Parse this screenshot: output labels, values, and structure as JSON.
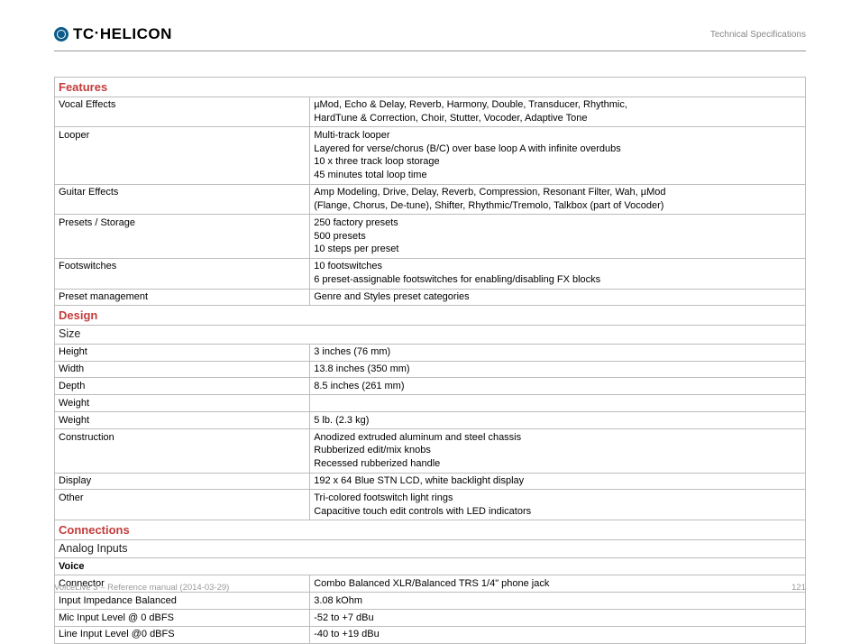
{
  "header": {
    "logo_text_1": "TC",
    "logo_sep": "·",
    "logo_text_2": "HELICON",
    "right_text": "Technical Specifications"
  },
  "sections": {
    "features": {
      "title": "Features",
      "rows": [
        {
          "label": "Vocal Effects",
          "value": "µMod, Echo & Delay, Reverb, Harmony, Double, Transducer, Rhythmic,\nHardTune & Correction, Choir, Stutter, Vocoder, Adaptive Tone"
        },
        {
          "label": "Looper",
          "value": "Multi-track looper\nLayered for verse/chorus (B/C) over base loop A with infinite overdubs\n10 x three track loop storage\n45 minutes total loop time"
        },
        {
          "label": "Guitar Effects",
          "value": "Amp Modeling, Drive, Delay, Reverb, Compression, Resonant Filter, Wah, µMod\n(Flange, Chorus, De-tune), Shifter, Rhythmic/Tremolo, Talkbox (part of Vocoder)"
        },
        {
          "label": "Presets / Storage",
          "value": "250 factory presets\n500 presets\n10 steps per preset"
        },
        {
          "label": "Footswitches",
          "value": "10 footswitches\n6 preset-assignable footswitches for enabling/disabling FX blocks"
        },
        {
          "label": "Preset management",
          "value": "Genre and Styles preset categories"
        }
      ]
    },
    "design": {
      "title": "Design",
      "sub": "Size",
      "rows": [
        {
          "label": "Height",
          "value": "3 inches (76 mm)"
        },
        {
          "label": "Width",
          "value": "13.8 inches (350 mm)"
        },
        {
          "label": "Depth",
          "value": "8.5 inches (261 mm)"
        },
        {
          "label": "Weight",
          "value": ""
        },
        {
          "label": "Weight",
          "value": "5 lb. (2.3 kg)"
        },
        {
          "label": "Construction",
          "value": "Anodized extruded aluminum and steel chassis\nRubberized edit/mix knobs\nRecessed rubberized handle"
        },
        {
          "label": "Display",
          "value": "192 x 64 Blue STN LCD, white backlight display"
        },
        {
          "label": "Other",
          "value": "Tri-colored footswitch light rings\nCapacitive touch edit controls with LED indicators"
        }
      ]
    },
    "connections": {
      "title": "Connections",
      "sub": "Analog Inputs",
      "sub2": "Voice",
      "rows": [
        {
          "label": "Connector",
          "value": "Combo Balanced XLR/Balanced TRS 1/4\" phone jack"
        },
        {
          "label": "Input Impedance Balanced",
          "value": "3.08 kOhm"
        },
        {
          "label": "Mic Input Level @ 0 dBFS",
          "value": "-52 to +7 dBu"
        },
        {
          "label": "Line Input Level @0 dBFS",
          "value": "-40 to +19 dBu"
        }
      ]
    }
  },
  "footer": {
    "left": "VoiceLive 3 – Reference manual (2014-03-29)",
    "right": "121"
  }
}
